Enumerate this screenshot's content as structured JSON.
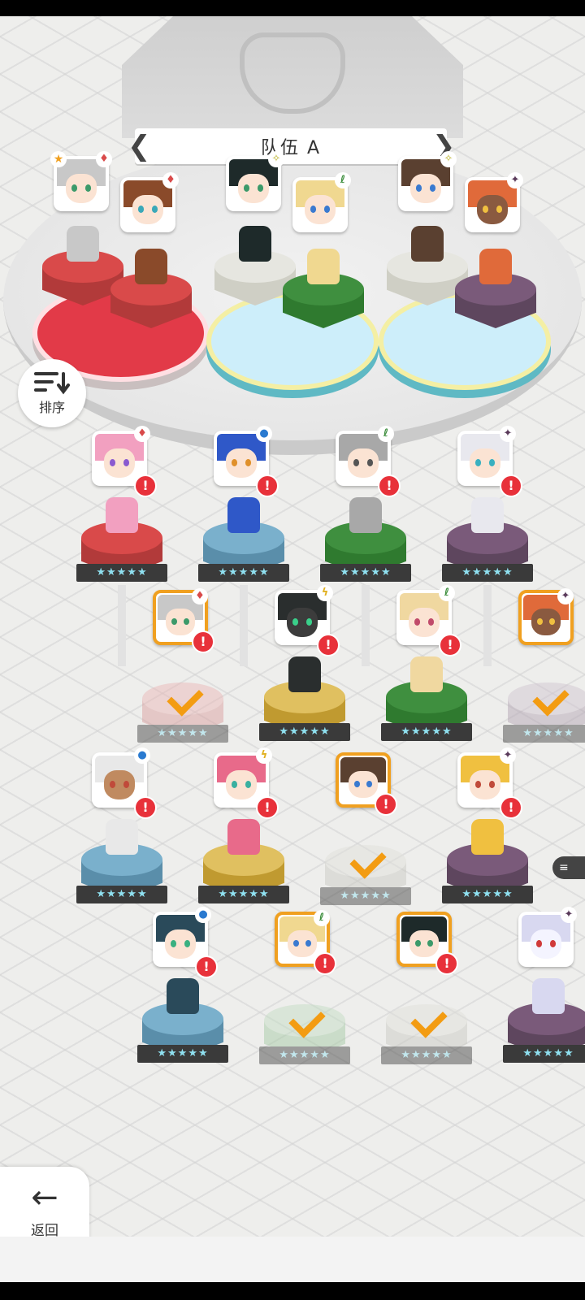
{
  "header": {
    "team_title": "队伍 A",
    "prev_arrow": "❮",
    "next_arrow": "❯"
  },
  "sort_button": {
    "label": "排序"
  },
  "back_button": {
    "label": "返回",
    "icon": "←"
  },
  "colors": {
    "fire": "#d94a4a",
    "water": "#7ab0cc",
    "grass": "#3f8f3f",
    "dark": "#7a5a7a",
    "light": "#e0c060",
    "neutral": "#e6e6e6",
    "alert": "#e8313a",
    "selected_border": "#f0a020"
  },
  "stars_text": "★★★★★",
  "alert_text": "!",
  "check_text": "",
  "side_chip_text": "≡"
}
